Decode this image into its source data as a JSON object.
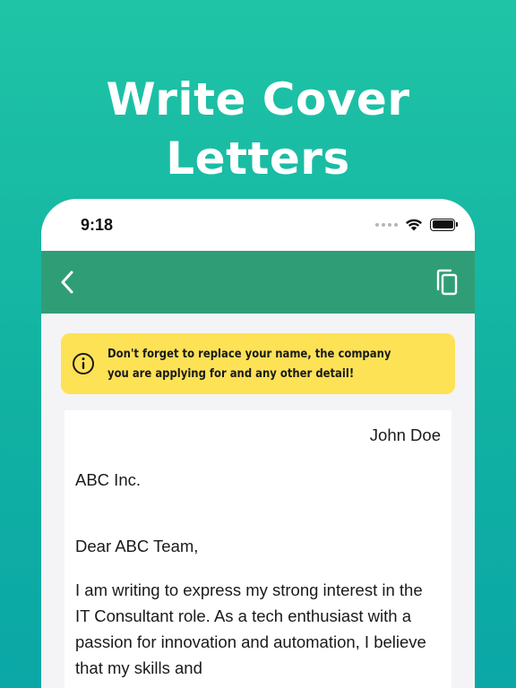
{
  "hero": {
    "title_line1": "Write Cover",
    "title_line2": "Letters"
  },
  "status_bar": {
    "time": "9:18",
    "icons": [
      "cellular-dots-icon",
      "wifi-icon",
      "battery-icon"
    ]
  },
  "nav": {
    "back_icon": "chevron-left-icon",
    "copy_icon": "copy-icon",
    "color": "#2f9e76"
  },
  "notice": {
    "icon": "info-icon",
    "text": "Don't forget to replace your name, the company you are applying for and any other detail!",
    "color": "#fde256"
  },
  "letter": {
    "sender": "John Doe",
    "company": "ABC Inc.",
    "greeting": "Dear ABC Team,",
    "body": "I am writing to express my strong interest in the IT Consultant role. As a tech enthusiast with a passion for innovation and automation, I believe that my skills and"
  },
  "colors": {
    "background_top": "#1fc4a6",
    "background_bottom": "#0aa7a6"
  }
}
